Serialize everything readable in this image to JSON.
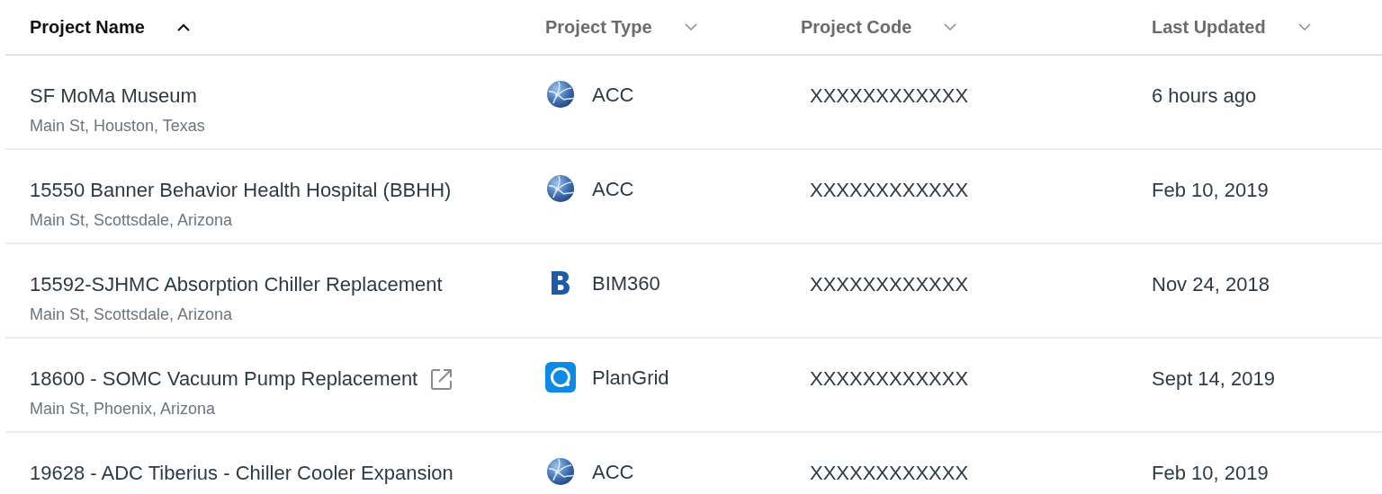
{
  "table": {
    "columns": [
      {
        "label": "Project Name",
        "sorted": true
      },
      {
        "label": "Project Type",
        "sorted": false
      },
      {
        "label": "Project Code",
        "sorted": false
      },
      {
        "label": "Last Updated",
        "sorted": false
      }
    ],
    "rows": [
      {
        "name": "SF MoMa Museum",
        "address": "Main St, Houston, Texas",
        "external": false,
        "type": {
          "kind": "acc",
          "label": "ACC"
        },
        "code": "XXXXXXXXXXXX",
        "updated": "6 hours ago"
      },
      {
        "name": "15550 Banner Behavior Health Hospital (BBHH)",
        "address": "Main St, Scottsdale, Arizona",
        "external": false,
        "type": {
          "kind": "acc",
          "label": "ACC"
        },
        "code": "XXXXXXXXXXXX",
        "updated": "Feb 10, 2019"
      },
      {
        "name": "15592-SJHMC Absorption Chiller Replacement",
        "address": "Main St, Scottsdale, Arizona",
        "external": false,
        "type": {
          "kind": "bim360",
          "label": "BIM360"
        },
        "code": "XXXXXXXXXXXX",
        "updated": "Nov 24, 2018"
      },
      {
        "name": "18600 - SOMC Vacuum Pump Replacement",
        "address": "Main St, Phoenix, Arizona",
        "external": true,
        "type": {
          "kind": "plangrid",
          "label": "PlanGrid"
        },
        "code": "XXXXXXXXXXXX",
        "updated": "Sept 14, 2019"
      },
      {
        "name": "19628 - ADC Tiberius - Chiller Cooler Expansion",
        "external": false,
        "type": {
          "kind": "acc",
          "label": "ACC"
        },
        "code": "XXXXXXXXXXXX",
        "updated": "Feb 10, 2019"
      }
    ]
  }
}
